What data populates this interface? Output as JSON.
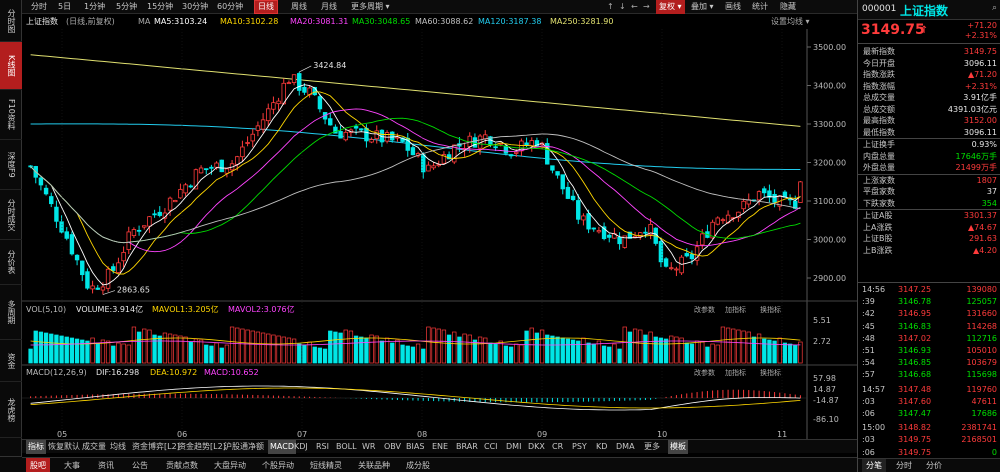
{
  "left_sidebar": [
    {
      "label": "分时图",
      "active": false
    },
    {
      "label": "K线图",
      "active": true
    },
    {
      "label": "F10资料",
      "active": false
    },
    {
      "label": "深度F9",
      "active": false
    },
    {
      "label": "分时成交",
      "active": false
    },
    {
      "label": "分价表",
      "active": false
    },
    {
      "label": "多周期",
      "active": false
    },
    {
      "label": "资金",
      "active": false
    },
    {
      "label": "龙虎榜",
      "active": false
    }
  ],
  "toolbar": {
    "periods": [
      "分时",
      "5日",
      "1分钟",
      "5分钟",
      "15分钟",
      "30分钟",
      "60分钟",
      "日线",
      "周线",
      "月线",
      "更多周期 ▾"
    ],
    "active_period": "日线",
    "right_buttons": [
      "复权 ▾",
      "叠加 ▾",
      "画线",
      "统计",
      "隐藏"
    ],
    "arrows": [
      "↑",
      "↓",
      "←",
      "→"
    ],
    "fuquan_label": "复权 ▾"
  },
  "infobar": {
    "title": "上证指数",
    "subtitle": "(日线,前复权)",
    "ma_label": "MA",
    "ma5": "MA5:3103.24",
    "ma10": "MA10:3102.28",
    "ma20": "MA20:3081.31",
    "ma30": "MA30:3048.65",
    "ma60": "MA60:3088.62",
    "ma120": "MA120:3187.38",
    "ma250": "MA250:3281.90",
    "settings": "设置均线 ▾",
    "colors": {
      "ma5": "#ffffff",
      "ma10": "#ffd700",
      "ma20": "#ff44ff",
      "ma30": "#00dd00",
      "ma60": "#c0c0c0",
      "ma120": "#22ccee",
      "ma250": "#e0e070"
    }
  },
  "chart_data": {
    "type": "candlestick",
    "price_axis": {
      "ticks": [
        "3500.00",
        "3400.00",
        "3300.00",
        "3200.00",
        "3100.00",
        "3000.00",
        "2900.00"
      ],
      "range": [
        2840,
        3530
      ]
    },
    "annotations": {
      "high": "3424.84",
      "low": "2863.65"
    },
    "month_labels": [
      "05",
      "06",
      "07",
      "08",
      "09",
      "10",
      "11"
    ],
    "volume": {
      "label": "VOL(5,10)",
      "volume": "VOLUME:3.914亿",
      "mavol1": "MAVOL1:3.205亿",
      "mavol2": "MAVOL2:3.076亿",
      "axis": [
        "5.51",
        "2.72"
      ],
      "buttons": [
        "改参数",
        "加指标",
        "换指标"
      ]
    },
    "macd": {
      "label": "MACD(12,26,9)",
      "dif": "DIF:16.298",
      "dea": "DEA:10.972",
      "macd": "MACD:10.652",
      "axis": [
        "57.98",
        "14.87",
        "-14.87",
        "-86.10"
      ],
      "buttons": [
        "改参数",
        "加指标",
        "换指标"
      ]
    }
  },
  "indicator_tabs": {
    "items": [
      "指标",
      "恢复默认",
      "成交量",
      "均线",
      "资金博弈[L2]",
      "资金趋势[L2]",
      "沪股通净额",
      "MACD",
      "KDJ",
      "RSI",
      "BOLL",
      "WR",
      "OBV",
      "BIAS",
      "ENE",
      "BRAR",
      "CCI",
      "DMI",
      "DKX",
      "CR",
      "PSY",
      "KD",
      "DMA",
      "更多",
      "模板"
    ],
    "active": [
      "指标",
      "MACD",
      "模板"
    ]
  },
  "bottom_tabs": {
    "items": [
      "股吧",
      "大事",
      "资讯",
      "公告",
      "贡献点数",
      "大盘异动",
      "个股异动",
      "短线精灵",
      "关联品种",
      "成分股"
    ],
    "active": "股吧"
  },
  "right_panel": {
    "code": "000001",
    "name": "上证指数",
    "price": "3149.75",
    "change": "+71.20",
    "change_pct": "+2.31%",
    "stats": [
      {
        "label": "最新指数",
        "value": "3149.75",
        "color": "red"
      },
      {
        "label": "今日开盘",
        "value": "3096.11",
        "color": "white"
      },
      {
        "label": "指数涨跌",
        "value": "▲71.20",
        "color": "red"
      },
      {
        "label": "指数涨幅",
        "value": "+2.31%",
        "color": "red"
      },
      {
        "label": "总成交量",
        "value": "3.91亿手",
        "color": "white"
      },
      {
        "label": "总成交额",
        "value": "4391.03亿元",
        "color": "white"
      },
      {
        "label": "最高指数",
        "value": "3152.00",
        "color": "red"
      },
      {
        "label": "最低指数",
        "value": "3096.11",
        "color": "white"
      },
      {
        "label": "上证换手",
        "value": "0.93%",
        "color": "white"
      },
      {
        "label": "内盘总量",
        "value": "17646万手",
        "color": "green"
      },
      {
        "label": "外盘总量",
        "value": "21499万手",
        "color": "red"
      },
      {
        "label": "上涨家数",
        "value": "1807",
        "color": "red"
      },
      {
        "label": "平盘家数",
        "value": "37",
        "color": "white"
      },
      {
        "label": "下跌家数",
        "value": "354",
        "color": "green"
      },
      {
        "label": "上证A股",
        "value": "3301.37",
        "color": "red"
      },
      {
        "label": "上A涨跌",
        "value": "▲74.67",
        "color": "red"
      },
      {
        "label": "上证B股",
        "value": "291.63",
        "color": "red"
      },
      {
        "label": "上B涨跌",
        "value": "▲4.20",
        "color": "red"
      }
    ],
    "trades": [
      {
        "time": "14:56",
        "price": "3147.25",
        "vol": "139080"
      },
      {
        "time": ":39",
        "price": "3146.78",
        "vol": "125057"
      },
      {
        "time": ":42",
        "price": "3146.95",
        "vol": "131660"
      },
      {
        "time": ":45",
        "price": "3146.83",
        "vol": "114268"
      },
      {
        "time": ":48",
        "price": "3147.02",
        "vol": "112716"
      },
      {
        "time": ":51",
        "price": "3146.93",
        "vol": "105010"
      },
      {
        "time": ":54",
        "price": "3146.85",
        "vol": "103679"
      },
      {
        "time": ":57",
        "price": "3146.68",
        "vol": "115698"
      },
      {
        "time": "14:57",
        "price": "3147.48",
        "vol": "119760"
      },
      {
        "time": ":03",
        "price": "3147.60",
        "vol": "47611"
      },
      {
        "time": ":06",
        "price": "3147.47",
        "vol": "17686"
      },
      {
        "time": "15:00",
        "price": "3148.82",
        "vol": "2381741"
      },
      {
        "time": ":03",
        "price": "3149.75",
        "vol": "2168501"
      },
      {
        "time": ":06",
        "price": "3149.75",
        "vol": "0"
      }
    ],
    "tabs": [
      "分笔",
      "分时",
      "分价"
    ],
    "active_tab": "分笔"
  }
}
